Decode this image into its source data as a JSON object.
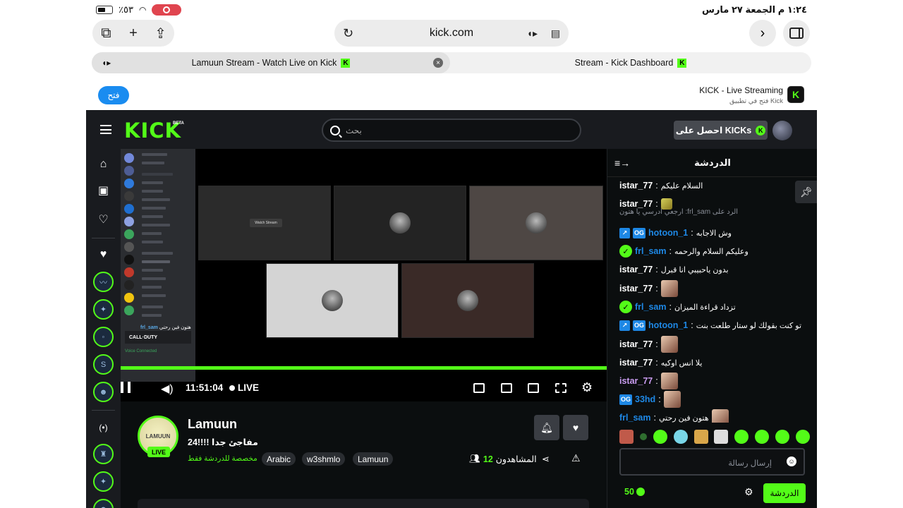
{
  "status_bar": {
    "battery": "٪٥٣",
    "datetime": "١:٢٤ م  الجمعة ٢٧ مارس"
  },
  "browser": {
    "url": "kick.com",
    "tabs": [
      {
        "title": "Lamuun Stream - Watch Live on Kick"
      },
      {
        "title": "Stream - Kick Dashboard"
      }
    ]
  },
  "app_banner": {
    "open_label": "فتح",
    "title": "KICK - Live Streaming",
    "subtitle": "فتح في تطبيق Kick"
  },
  "site_header": {
    "logo": "KICK",
    "beta": "BETA",
    "search_placeholder": "بحث",
    "get_kicks_label": "احصل على KICKs"
  },
  "player": {
    "discord": {
      "game_banner": "CALL·DUTY",
      "voice_status": "Voice Connected",
      "message_user": "frl_sam",
      "message_text": "هتون فين رحتي"
    },
    "watch_stream_label": "Watch Stream",
    "time": "11:51:04",
    "live_label": "LIVE",
    "progress_percent": 100
  },
  "stream_info": {
    "streamer_name": "Lamuun",
    "avatar_text": "LAMUUN",
    "live_badge": "LIVE",
    "title": "مفاجئ جدا !!!!24",
    "chat_only": "مخصصة للدردشة فقط",
    "tags": [
      "Arabic",
      "w3shmlo",
      "Lamuun"
    ],
    "viewers_label": "المشاهدون",
    "viewers_count": "12"
  },
  "chat": {
    "title": "الدردشة",
    "reply_context": "ارجعي ادرسي يا هتون :frl_sam الرد على",
    "messages": [
      {
        "user": "istar_77",
        "text": "السلام عليكم",
        "color": "#ffffff",
        "badges": [],
        "emote": false
      },
      {
        "user": "istar_77",
        "text": "",
        "color": "#ffffff",
        "badges": [],
        "emote": "small"
      },
      {
        "user": "hotoon_1",
        "text": "وش الاجابه",
        "color": "#1e88e5",
        "badges": [
          "sq",
          "og"
        ],
        "emote": false
      },
      {
        "user": "frl_sam",
        "text": "وعليكم السلام والرحمه",
        "color": "#1e88e5",
        "badges": [
          "verified"
        ],
        "emote": false
      },
      {
        "user": "istar_77",
        "text": "بدون ياحبيبي انا قبرل",
        "color": "#ffffff",
        "badges": [],
        "emote": false
      },
      {
        "user": "istar_77",
        "text": "",
        "color": "#ffffff",
        "badges": [],
        "emote": "img"
      },
      {
        "user": "frl_sam",
        "text": "تزداد قراءة الميزان",
        "color": "#1e88e5",
        "badges": [
          "verified"
        ],
        "emote": false
      },
      {
        "user": "hotoon_1",
        "text": "تو كنت بقولك لو ستار طلعت بنت",
        "color": "#1e88e5",
        "badges": [
          "sq",
          "og"
        ],
        "emote": false
      },
      {
        "user": "istar_77",
        "text": "",
        "color": "#ffffff",
        "badges": [],
        "emote": "img"
      },
      {
        "user": "istar_77",
        "text": "يلا انس اوكيه",
        "color": "#ffffff",
        "badges": [],
        "emote": false
      },
      {
        "user": "istar_77",
        "text": "",
        "color": "#c99cf0",
        "badges": [],
        "emote": "img"
      },
      {
        "user": "33hd",
        "text": "",
        "color": "#1e88e5",
        "badges": [
          "og"
        ],
        "emote": "img"
      },
      {
        "user": "frl_sam",
        "text": "هتون فين رحتي",
        "color": "#1e88e5",
        "badges": [],
        "emote": "img"
      }
    ],
    "input_placeholder": "إرسال رسالة",
    "points": "50",
    "send_label": "الدردشة"
  },
  "colors": {
    "brand": "#53fc18",
    "background": "#0b0e0f",
    "panel": "#191b1f"
  }
}
